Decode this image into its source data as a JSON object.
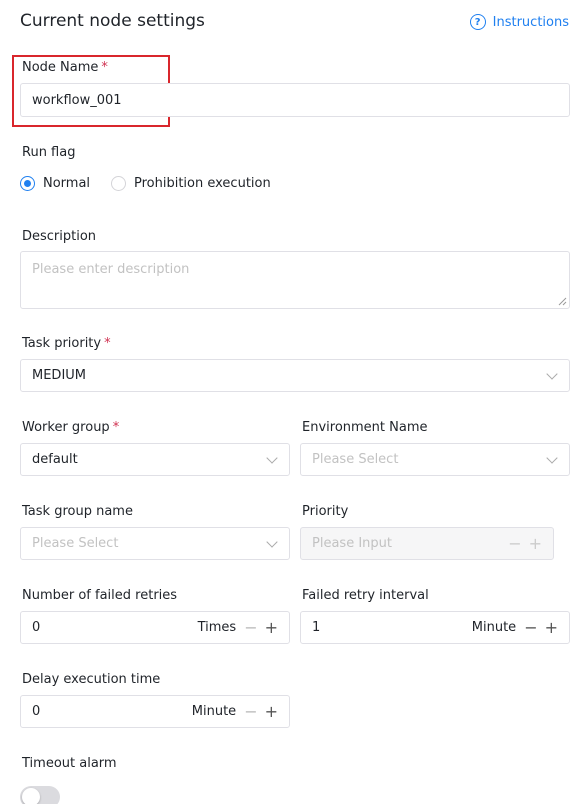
{
  "header": {
    "title": "Current node settings",
    "instructions_label": "Instructions",
    "help_glyph": "?"
  },
  "node_name": {
    "label": "Node Name",
    "required_mark": "*",
    "value": "workflow_001"
  },
  "run_flag": {
    "label": "Run flag",
    "options": [
      "Normal",
      "Prohibition execution"
    ],
    "selected": "Normal"
  },
  "description": {
    "label": "Description",
    "placeholder": "Please enter description"
  },
  "task_priority": {
    "label": "Task priority",
    "required_mark": "*",
    "value": "MEDIUM"
  },
  "worker_group": {
    "label": "Worker group",
    "required_mark": "*",
    "value": "default"
  },
  "environment_name": {
    "label": "Environment Name",
    "placeholder": "Please Select"
  },
  "task_group_name": {
    "label": "Task group name",
    "placeholder": "Please Select"
  },
  "priority": {
    "label": "Priority",
    "placeholder": "Please Input"
  },
  "failed_retries": {
    "label": "Number of failed retries",
    "value": "0",
    "unit": "Times"
  },
  "retry_interval": {
    "label": "Failed retry interval",
    "value": "1",
    "unit": "Minute"
  },
  "delay_time": {
    "label": "Delay execution time",
    "value": "0",
    "unit": "Minute"
  },
  "timeout_alarm": {
    "label": "Timeout alarm",
    "enabled": false
  },
  "stepper": {
    "minus": "−",
    "plus": "+"
  },
  "colors": {
    "accent": "#2080f0",
    "required": "#d03050",
    "highlight_box": "#d9262c"
  }
}
